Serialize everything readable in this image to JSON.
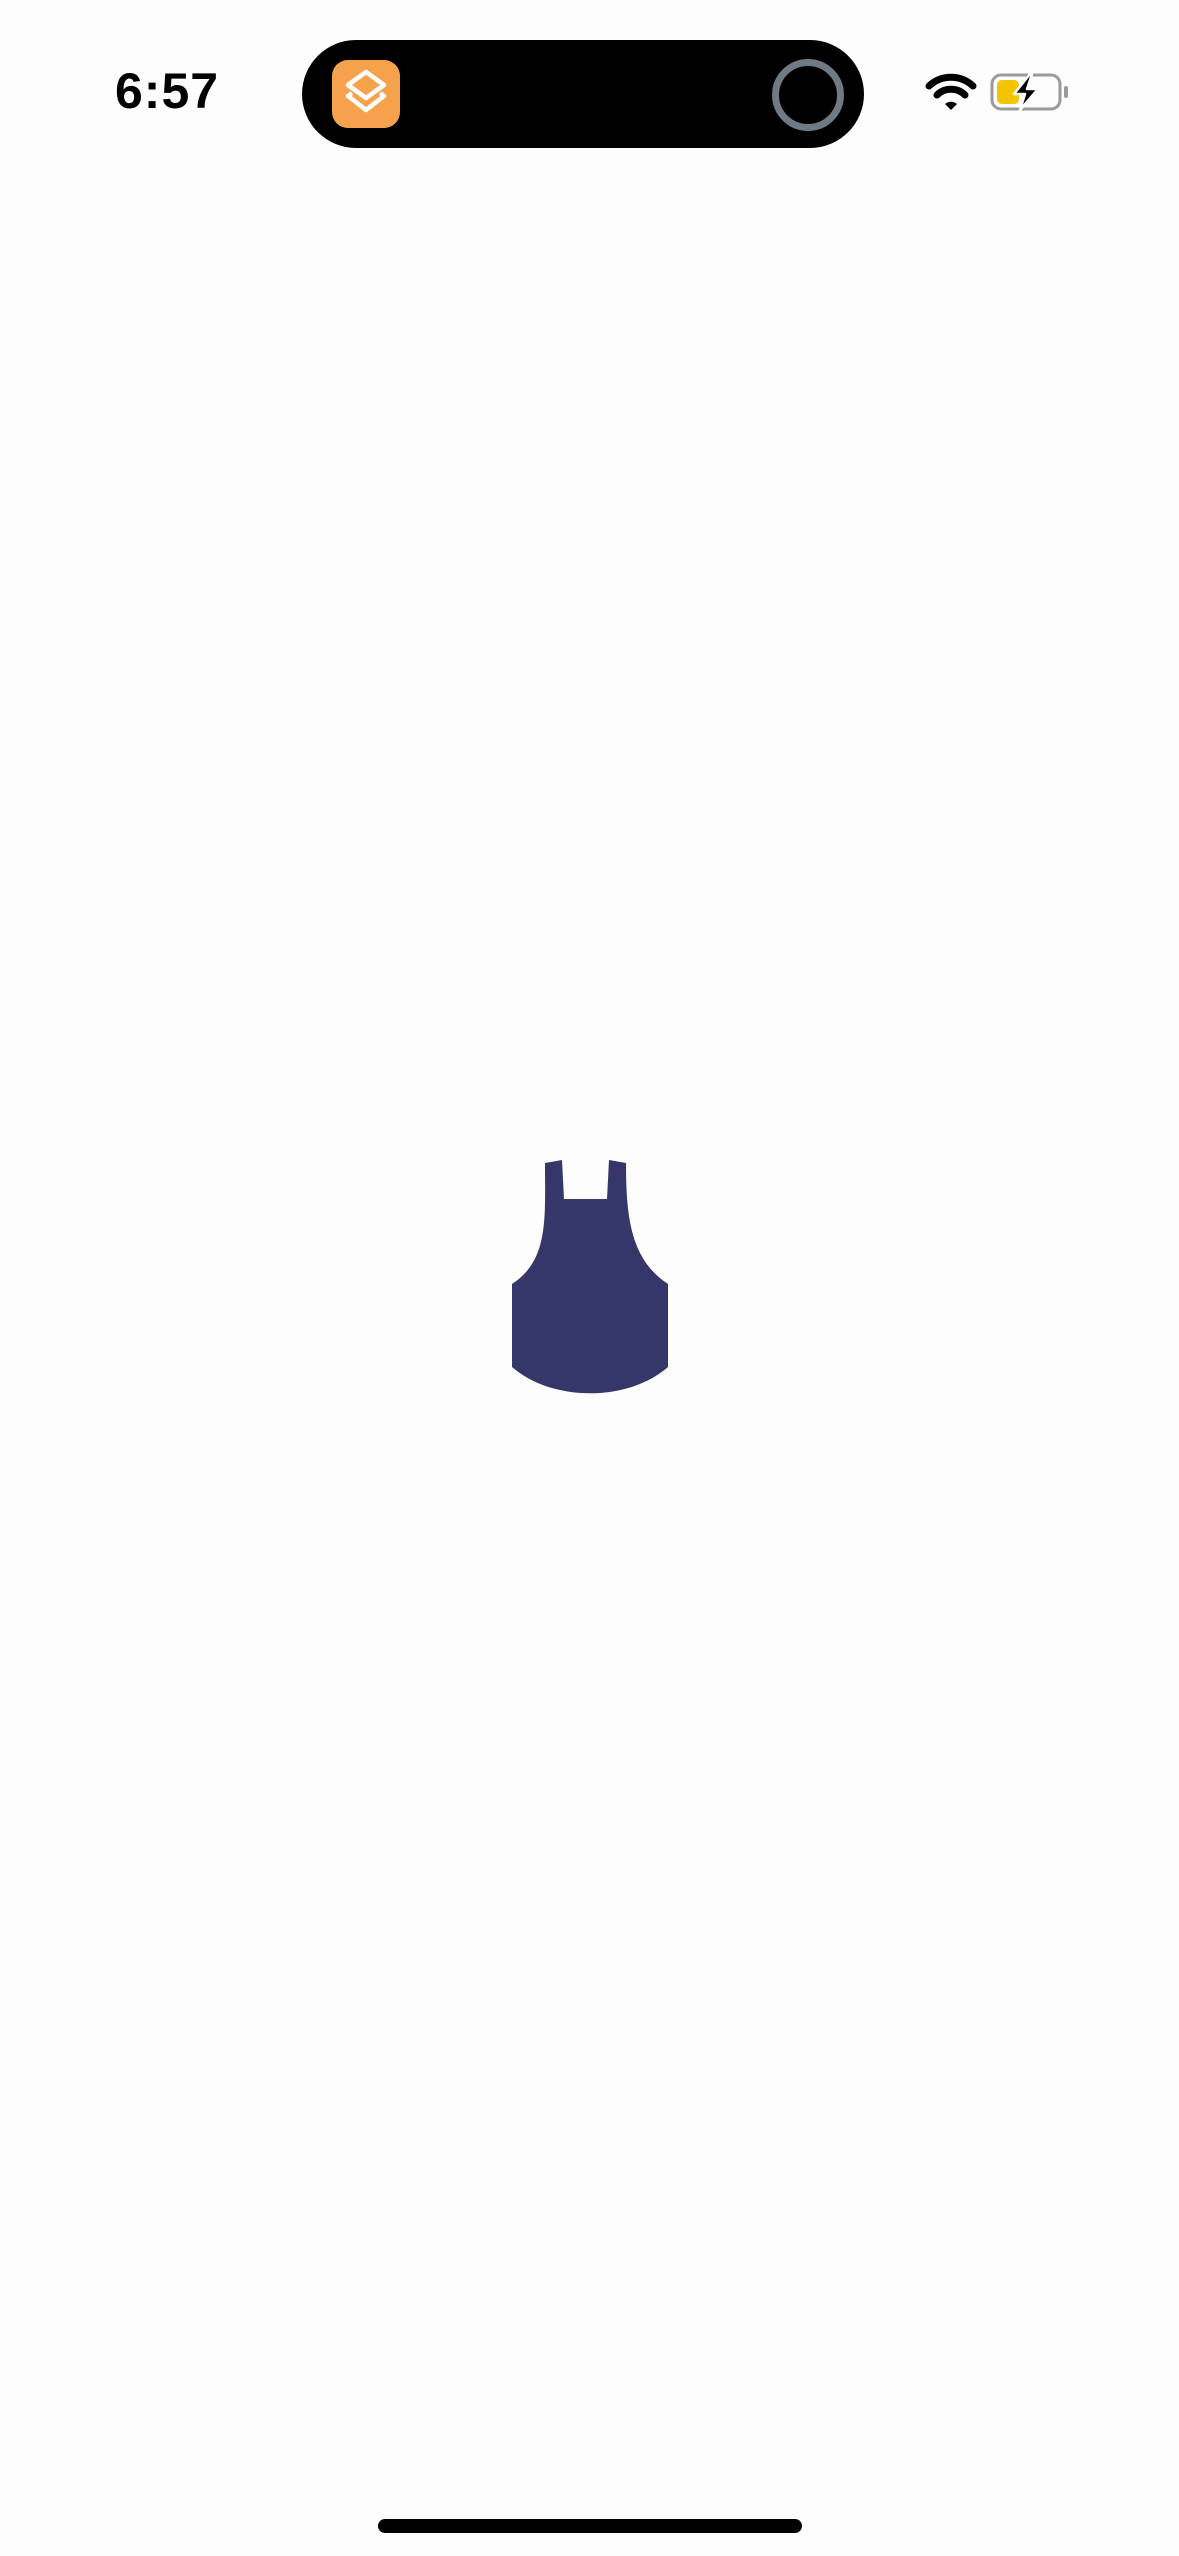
{
  "status_bar": {
    "time": "6:57",
    "wifi_icon": "wifi-icon",
    "battery_icon": "battery-charging-icon",
    "battery_color": "#f5c400"
  },
  "dynamic_island": {
    "app_icon": "layers-app-icon",
    "app_icon_color": "#f6a24c",
    "activity_icon": "ring-icon"
  },
  "main": {
    "logo_icon": "apron-logo-icon",
    "logo_color": "#35376a"
  }
}
